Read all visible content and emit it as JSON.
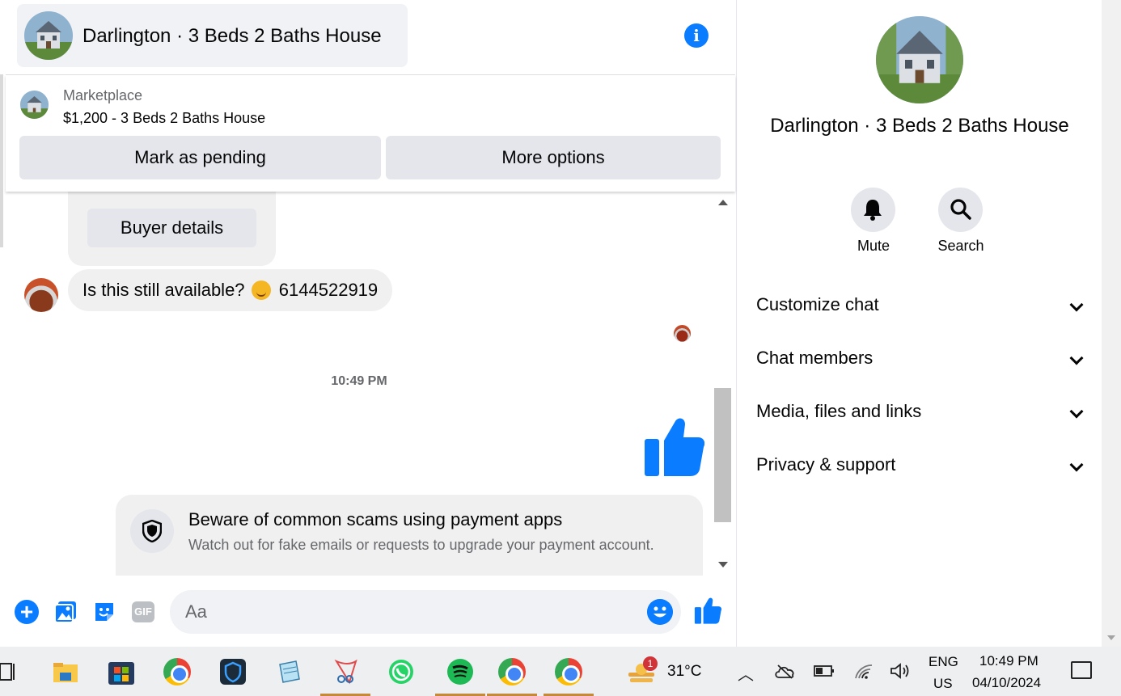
{
  "header": {
    "title": "Darlington · 3 Beds 2 Baths House",
    "avatar_icon": "house-photo",
    "info_icon": "info-icon"
  },
  "marketplace": {
    "label": "Marketplace",
    "listing": "$1,200 - 3 Beds 2 Baths House",
    "mark_pending": "Mark as pending",
    "more_options": "More options"
  },
  "messages": {
    "buyer_details": "Buyer details",
    "incoming_text": "Is this still available?",
    "incoming_emoji": "smiling-face-emoji",
    "incoming_phone": "6144522919",
    "timestamp": "10:49 PM",
    "sent_like_icon": "thumbs-up-icon"
  },
  "scam_notice": {
    "title": "Beware of common scams using payment apps",
    "body": "Watch out for fake emails or requests to upgrade your payment account."
  },
  "composer": {
    "placeholder": "Aa",
    "gif_label": "GIF"
  },
  "right_panel": {
    "title": "Darlington · 3 Beds 2 Baths House",
    "mute_label": "Mute",
    "search_label": "Search",
    "sections": [
      "Customize chat",
      "Chat members",
      "Media, files and links",
      "Privacy & support"
    ]
  },
  "taskbar": {
    "notification_count": "1",
    "temperature": "31°C",
    "lang_line1": "ENG",
    "lang_line2": "US",
    "time": "10:49 PM",
    "date": "04/10/2024"
  },
  "colors": {
    "accent": "#0a7cff",
    "bubble": "#f0f0f0",
    "button_gray": "#e4e6eb"
  }
}
